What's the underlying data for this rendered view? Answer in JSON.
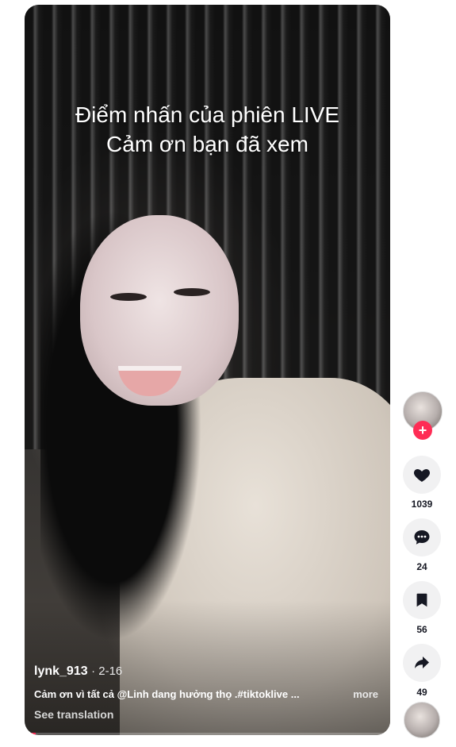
{
  "video": {
    "overlay_line1": "Điểm nhấn của phiên LIVE",
    "overlay_line2": "Cảm ơn bạn đã xem",
    "author": "lynk_913",
    "date": "2-16",
    "date_separator": "·",
    "description": "Cảm ơn vì tất cả @Linh dang hưởng thọ .#tiktoklive ...",
    "more_label": "more",
    "translation_label": "See translation",
    "progress_percent": 3
  },
  "actions": {
    "follow_label": "+",
    "likes": "1039",
    "comments": "24",
    "saves": "56",
    "shares": "49"
  },
  "colors": {
    "accent": "#fe2c55",
    "action_bg": "#f1f1f2",
    "icon": "#161823"
  },
  "icons": {
    "like": "heart-icon",
    "comment": "comment-bubble-icon",
    "save": "bookmark-icon",
    "share": "share-arrow-icon",
    "follow": "plus-icon"
  }
}
